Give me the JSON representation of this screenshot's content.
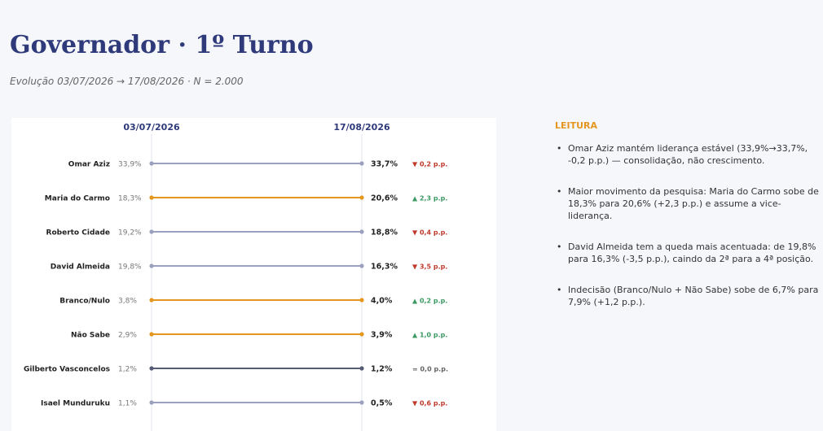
{
  "page": {
    "title": "Governador · 1º Turno",
    "subtitle": "Evolução 03/07/2026 → 17/08/2026 · N = 2.000"
  },
  "colors": {
    "up": "#e5961f",
    "down": "#9aa0bd",
    "flat": "#555a75",
    "pos_delta": "#3c9a63",
    "neg_delta": "#c0392b",
    "neutral_delta": "#666666"
  },
  "chart_data": {
    "type": "slope",
    "columns": [
      "03/07/2026",
      "17/08/2026"
    ],
    "rows": [
      {
        "name": "Omar Aziz",
        "start": 33.9,
        "start_label": "33,9%",
        "end": 33.7,
        "end_label": "33,7%",
        "trend": "down",
        "delta_label": "▼ 0,2 p.p."
      },
      {
        "name": "Maria do Carmo",
        "start": 18.3,
        "start_label": "18,3%",
        "end": 20.6,
        "end_label": "20,6%",
        "trend": "up",
        "delta_label": "▲ 2,3 p.p."
      },
      {
        "name": "Roberto Cidade",
        "start": 19.2,
        "start_label": "19,2%",
        "end": 18.8,
        "end_label": "18,8%",
        "trend": "down",
        "delta_label": "▼ 0,4 p.p."
      },
      {
        "name": "David Almeida",
        "start": 19.8,
        "start_label": "19,8%",
        "end": 16.3,
        "end_label": "16,3%",
        "trend": "down",
        "delta_label": "▼ 3,5 p.p."
      },
      {
        "name": "Branco/Nulo",
        "start": 3.8,
        "start_label": "3,8%",
        "end": 4.0,
        "end_label": "4,0%",
        "trend": "up",
        "delta_label": "▲ 0,2 p.p."
      },
      {
        "name": "Não Sabe",
        "start": 2.9,
        "start_label": "2,9%",
        "end": 3.9,
        "end_label": "3,9%",
        "trend": "up",
        "delta_label": "▲ 1,0 p.p."
      },
      {
        "name": "Gilberto Vasconcelos",
        "start": 1.2,
        "start_label": "1,2%",
        "end": 1.2,
        "end_label": "1,2%",
        "trend": "flat",
        "delta_label": "= 0,0 p.p."
      },
      {
        "name": "Isael Munduruku",
        "start": 1.1,
        "start_label": "1,1%",
        "end": 0.5,
        "end_label": "0,5%",
        "trend": "down",
        "delta_label": "▼ 0,6 p.p."
      }
    ]
  },
  "notes": {
    "heading": "LEITURA",
    "items": [
      "Omar Aziz mantém liderança estável (33,9%→33,7%, -0,2 p.p.) — consolidação, não crescimento.",
      "Maior movimento da pesquisa: Maria do Carmo sobe de 18,3% para 20,6% (+2,3 p.p.) e assume a vice-liderança.",
      "David Almeida tem a queda mais acentuada: de 19,8% para 16,3% (-3,5 p.p.), caindo da 2ª para a 4ª posição.",
      "Indecisão (Branco/Nulo + Não Sabe) sobe de 6,7% para 7,9% (+1,2 p.p.)."
    ]
  }
}
